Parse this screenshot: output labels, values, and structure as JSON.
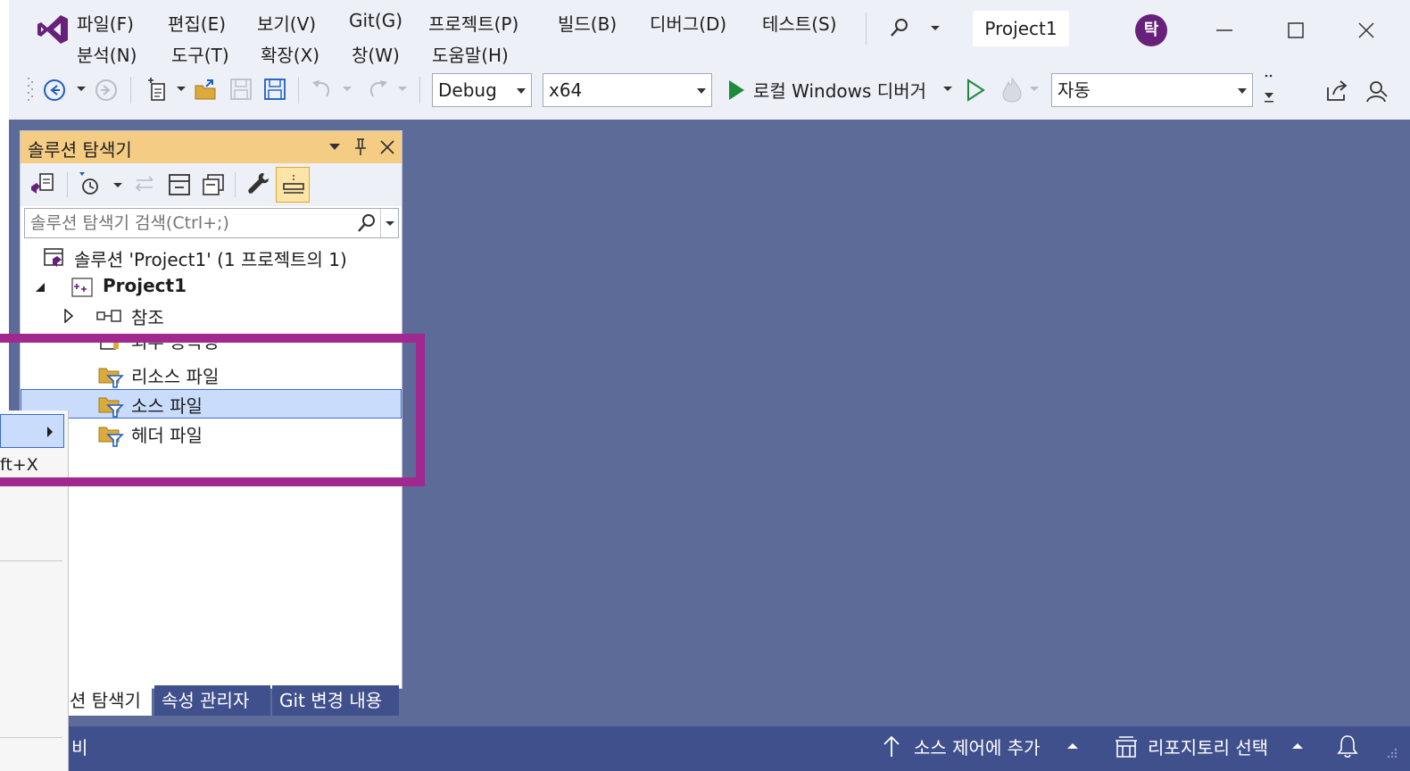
{
  "menu": {
    "row1": [
      "파일(F)",
      "편집(E)",
      "보기(V)",
      "Git(G)",
      "프로젝트(P)",
      "빌드(B)",
      "디버그(D)",
      "테스트(S)"
    ],
    "row2": [
      "분석(N)",
      "도구(T)",
      "확장(X)",
      "창(W)",
      "도움말(H)"
    ]
  },
  "title": {
    "project": "Project1",
    "avatar_initial": "탁"
  },
  "toolbar": {
    "config": "Debug",
    "platform": "x64",
    "run_label": "로컬 Windows 디버거",
    "auto": "자동"
  },
  "solution_explorer": {
    "header": "솔루션 탐색기",
    "search_placeholder": "솔루션 탐색기 검색(Ctrl+;)",
    "tree": {
      "solution": "솔루션 'Project1' (1 프로젝트의 1)",
      "project": "Project1",
      "references": "참조",
      "external": "외부 종속성",
      "resources": "리소스 파일",
      "sources": "소스 파일",
      "headers": "헤더 파일"
    }
  },
  "tabs": [
    "션 탐색기",
    "속성 관리자",
    "Git 변경 내용"
  ],
  "context_menu": {
    "shortcut": "ft+X"
  },
  "status": {
    "left": "비",
    "add_to_source_control": "소스 제어에 추가",
    "select_repo": "리포지토리 선택"
  },
  "colors": {
    "workspace": "#5d6b99",
    "status_bar": "#40508d",
    "panel_header": "#f5cc84",
    "highlight": "#a0288f",
    "vs_purple": "#68217a"
  }
}
